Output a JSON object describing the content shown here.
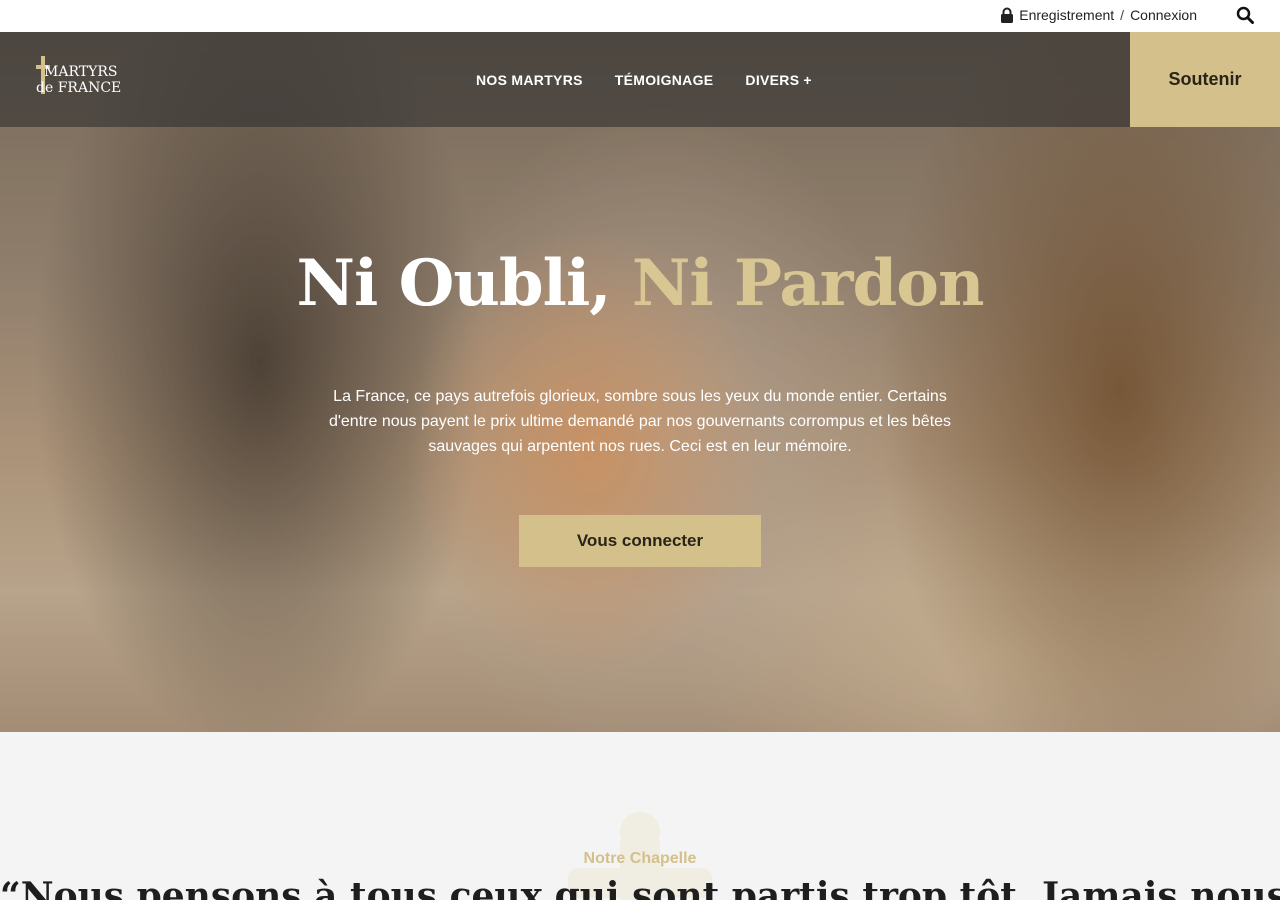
{
  "topbar": {
    "register_label": "Enregistrement",
    "separator": "/",
    "login_label": "Connexion"
  },
  "nav": {
    "logo_line1": "MARTYRS",
    "logo_line2": "de FRANCE",
    "items": [
      {
        "label": "NOS MARTYRS"
      },
      {
        "label": "TÉMOIGNAGE"
      },
      {
        "label": "DIVERS"
      }
    ],
    "divers_plus": "+",
    "support_label": "Soutenir"
  },
  "hero": {
    "title_white": "Ni Oubli,",
    "title_gold": "Ni Pardon",
    "text": "La France, ce pays autrefois glorieux, sombre sous les yeux du monde entier. Certains d'entre nous payent le prix ultime demandé par nos gouvernants corrompus et les bêtes sauvages qui arpentent nos rues. Ceci est en leur mémoire.",
    "cta_label": "Vous connecter"
  },
  "section": {
    "label": "Notre Chapelle",
    "quote": "“Nous pensons à tous ceux qui sont partis trop tôt. Jamais nous"
  },
  "colors": {
    "accent": "#d4c08a",
    "gold_text": "#d8c693"
  },
  "icons": {
    "lock": "lock-icon",
    "search": "search-icon",
    "cross": "cross-icon",
    "chapel": "chapel-icon"
  }
}
